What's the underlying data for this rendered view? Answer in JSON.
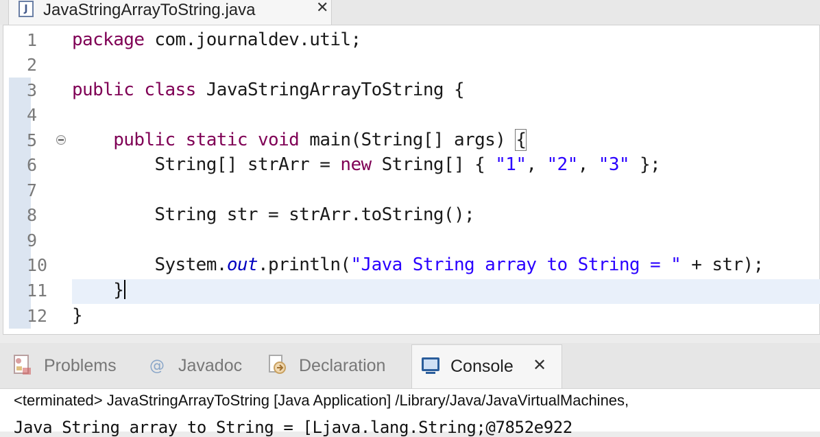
{
  "editor_tab": {
    "icon": "java-file-icon",
    "icon_letter": "J",
    "title": "JavaStringArrayToString.java",
    "close_glyph": "✕"
  },
  "editor": {
    "line_numbers": [
      "1",
      "2",
      "3",
      "4",
      "5",
      "6",
      "7",
      "8",
      "9",
      "10",
      "11",
      "12"
    ],
    "lines": [
      "package com.journaldev.util;",
      "",
      "public class JavaStringArrayToString {",
      "",
      "    public static void main(String[] args) {",
      "        String[] strArr = new String[] { \"1\", \"2\", \"3\" };",
      "",
      "        String str = strArr.toString();",
      "",
      "        System.out.println(\"Java String array to String = \" + str);",
      "    }",
      "}"
    ],
    "tokens": {
      "l1_kw": "package",
      "l1_rest": " com.journaldev.util;",
      "l3_kw1": "public",
      "l3_kw2": "class",
      "l3_rest": " JavaStringArrayToString {",
      "l5_indent": "    ",
      "l5_kw1": "public",
      "l5_kw2": "static",
      "l5_kw3": "void",
      "l5_rest": " main(String[] args) ",
      "l5_brace": "{",
      "l6_indent": "        ",
      "l6_a": "String[] strArr = ",
      "l6_kw": "new",
      "l6_b": " String[] { ",
      "l6_s1": "\"1\"",
      "l6_c1": ", ",
      "l6_s2": "\"2\"",
      "l6_c2": ", ",
      "l6_s3": "\"3\"",
      "l6_end": " };",
      "l8_text": "        String str = strArr.toString();",
      "l10_indent": "        ",
      "l10_a": "System.",
      "l10_fld": "out",
      "l10_b": ".println(",
      "l10_str": "\"Java String array to String = \"",
      "l10_c": " + str);",
      "l11_text": "    }",
      "l12_text": "}"
    }
  },
  "panel": {
    "tabs": [
      {
        "label": "Problems",
        "icon": "problems-icon"
      },
      {
        "label": "Javadoc",
        "icon": "javadoc-icon"
      },
      {
        "label": "Declaration",
        "icon": "declaration-icon"
      },
      {
        "label": "Console",
        "icon": "console-icon",
        "active": true
      }
    ],
    "console_close_glyph": "✕"
  },
  "console": {
    "status": "<terminated> JavaStringArrayToString [Java Application] /Library/Java/JavaVirtualMachines,",
    "output": "Java String array to String = [Ljava.lang.String;@7852e922"
  }
}
